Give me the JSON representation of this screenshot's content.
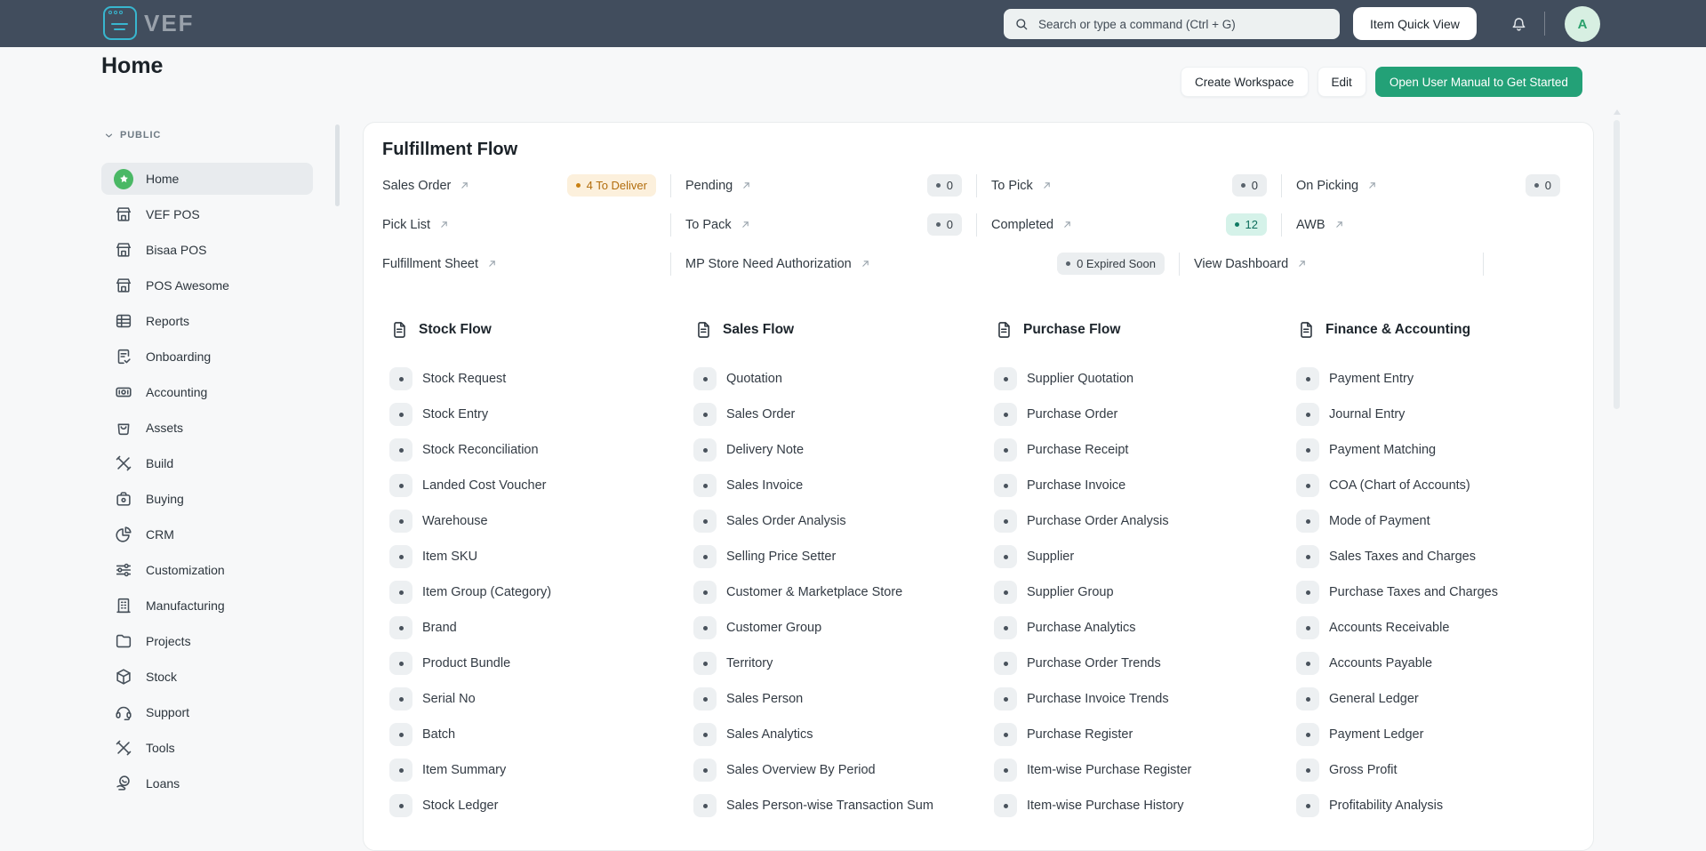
{
  "colors": {
    "navbar-bg": "#414d5d",
    "accent-green": "#23a177",
    "home-green": "#4ab865",
    "logo-teal": "#38b6cf",
    "avatar-bg": "#d7efe2",
    "avatar-text": "#2aa06b",
    "badge-gray-bg": "#ebeef0",
    "badge-gray-text": "#343c43",
    "badge-orange-bg": "#fcf0dc",
    "badge-orange-text": "#b26d0d",
    "badge-teal-bg": "#d5f2e9",
    "badge-teal-text": "#0e6e5c"
  },
  "navbar": {
    "brand": "VEF",
    "search_placeholder": "Search or type a command (Ctrl + G)",
    "quick_view_label": "Item Quick View",
    "avatar_letter": "A"
  },
  "header": {
    "title": "Home",
    "create_workspace": "Create Workspace",
    "edit": "Edit",
    "user_manual": "Open User Manual to Get Started"
  },
  "sidebar": {
    "section_label": "PUBLIC",
    "items": [
      {
        "label": "Home",
        "icon": "home-star",
        "active": true
      },
      {
        "label": "VEF POS",
        "icon": "shop",
        "active": false
      },
      {
        "label": "Bisaa POS",
        "icon": "shop",
        "active": false
      },
      {
        "label": "POS Awesome",
        "icon": "shop",
        "active": false
      },
      {
        "label": "Reports",
        "icon": "table",
        "active": false
      },
      {
        "label": "Onboarding",
        "icon": "doc-check",
        "active": false
      },
      {
        "label": "Accounting",
        "icon": "banknote",
        "active": false
      },
      {
        "label": "Assets",
        "icon": "bag",
        "active": false
      },
      {
        "label": "Build",
        "icon": "tools",
        "active": false
      },
      {
        "label": "Buying",
        "icon": "satchel",
        "active": false
      },
      {
        "label": "CRM",
        "icon": "pie",
        "active": false
      },
      {
        "label": "Customization",
        "icon": "sliders",
        "active": false
      },
      {
        "label": "Manufacturing",
        "icon": "building",
        "active": false
      },
      {
        "label": "Projects",
        "icon": "folder",
        "active": false
      },
      {
        "label": "Stock",
        "icon": "box",
        "active": false
      },
      {
        "label": "Support",
        "icon": "headset",
        "active": false
      },
      {
        "label": "Tools",
        "icon": "tools",
        "active": false
      },
      {
        "label": "Loans",
        "icon": "hand-coin",
        "active": false
      }
    ]
  },
  "fulfillment": {
    "title": "Fulfillment Flow",
    "rows": [
      {
        "segments": [
          {
            "label": "Sales Order",
            "badge": {
              "text": "4 To Deliver",
              "tone": "orange"
            }
          },
          {
            "label": "Pending",
            "badge": {
              "text": "0",
              "tone": "gray"
            }
          },
          {
            "label": "To Pick",
            "badge": {
              "text": "0",
              "tone": "gray"
            }
          },
          {
            "label": "On Picking",
            "badge": {
              "text": "0",
              "tone": "gray"
            }
          }
        ],
        "trailing_divider": false
      },
      {
        "segments": [
          {
            "label": "Pick List",
            "badge": null
          },
          {
            "label": "To Pack",
            "badge": {
              "text": "0",
              "tone": "gray"
            }
          },
          {
            "label": "Completed",
            "badge": {
              "text": "12",
              "tone": "teal"
            }
          },
          {
            "label": "AWB",
            "badge": null
          }
        ],
        "trailing_divider": false
      },
      {
        "segments": [
          {
            "label": "Fulfillment Sheet",
            "badge": null
          },
          {
            "label": "MP Store Need Authorization",
            "badge": {
              "text": "0 Expired Soon",
              "tone": "gray"
            }
          },
          {
            "label": "View Dashboard",
            "badge": null
          }
        ],
        "trailing_divider": true
      }
    ]
  },
  "columns": [
    {
      "title": "Stock Flow",
      "items": [
        "Stock Request",
        "Stock Entry",
        "Stock Reconciliation",
        "Landed Cost Voucher",
        "Warehouse",
        "Item SKU",
        "Item Group (Category)",
        "Brand",
        "Product Bundle",
        "Serial No",
        "Batch",
        "Item Summary",
        "Stock Ledger"
      ]
    },
    {
      "title": "Sales Flow",
      "items": [
        "Quotation",
        "Sales Order",
        "Delivery Note",
        "Sales Invoice",
        "Sales Order Analysis",
        "Selling Price Setter",
        "Customer & Marketplace Store",
        "Customer Group",
        "Territory",
        "Sales Person",
        "Sales Analytics",
        "Sales Overview By Period",
        "Sales Person-wise Transaction Sum"
      ]
    },
    {
      "title": "Purchase Flow",
      "items": [
        "Supplier Quotation",
        "Purchase Order",
        "Purchase Receipt",
        "Purchase Invoice",
        "Purchase Order Analysis",
        "Supplier",
        "Supplier Group",
        "Purchase Analytics",
        "Purchase Order Trends",
        "Purchase Invoice Trends",
        "Purchase Register",
        "Item-wise Purchase Register",
        "Item-wise Purchase History"
      ]
    },
    {
      "title": "Finance & Accounting",
      "items": [
        "Payment Entry",
        "Journal Entry",
        "Payment Matching",
        "COA (Chart of Accounts)",
        "Mode of Payment",
        "Sales Taxes and Charges",
        "Purchase Taxes and Charges",
        "Accounts Receivable",
        "Accounts Payable",
        "General Ledger",
        "Payment Ledger",
        "Gross Profit",
        "Profitability Analysis"
      ]
    }
  ]
}
